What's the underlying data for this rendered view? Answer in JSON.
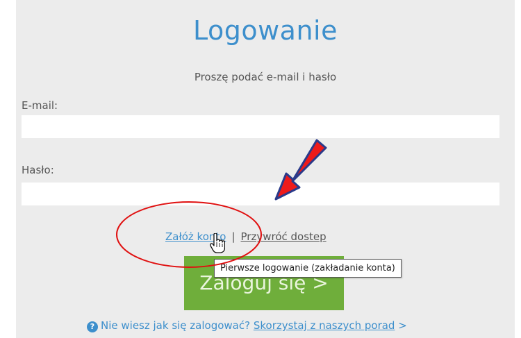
{
  "login": {
    "title": "Logowanie",
    "subtitle": "Proszę podać e-mail i hasło",
    "email_label": "E-mail:",
    "email_value": "",
    "password_label": "Hasło:",
    "password_value": "",
    "create_account_link": "Załóż konto",
    "separator": "|",
    "restore_access_link": "Przywróć dostep",
    "login_button": "Zaloguj się >",
    "tooltip": "Pierwsze logowanie (zakładanie konta)",
    "help_question": "Nie wiesz jak się zalogować?",
    "help_link": "Skorzystaj z naszych porad",
    "help_arrow": ">"
  },
  "colors": {
    "title": "#3d8fcc",
    "button": "#6fae3b",
    "annotation": "#e01010"
  },
  "icons": {
    "help": "question-circle-icon",
    "cursor": "hand-pointer-icon",
    "annotation_arrow": "red-arrow",
    "annotation_ellipse": "red-ellipse"
  }
}
